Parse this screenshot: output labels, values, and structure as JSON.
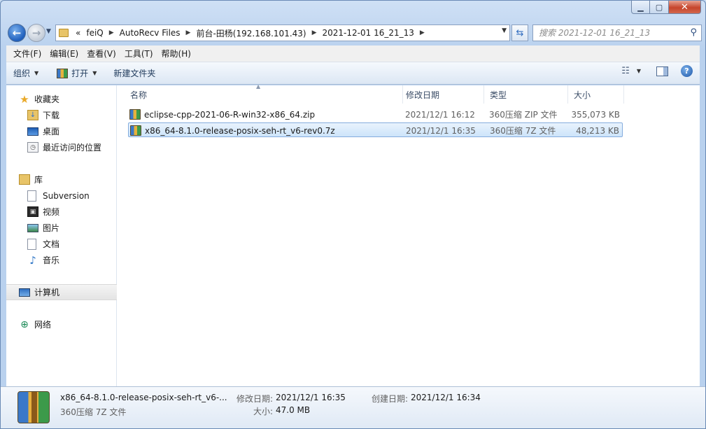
{
  "window": {
    "caption": {
      "minimize": "▁",
      "maximize": "▢",
      "close": "✕"
    }
  },
  "address": {
    "crumbs": [
      "«",
      "feiQ",
      "AutoRecv Files",
      "前台-田杨(192.168.101.43)",
      "2021-12-01 16_21_13"
    ],
    "separator": "▶",
    "dropdown": "▼"
  },
  "search": {
    "placeholder": "搜索 2021-12-01 16_21_13",
    "icon": "search-icon"
  },
  "menu": [
    "文件(F)",
    "编辑(E)",
    "查看(V)",
    "工具(T)",
    "帮助(H)"
  ],
  "toolbar": {
    "organize": "组织",
    "open": "打开",
    "new_folder": "新建文件夹",
    "dropdown": "▼"
  },
  "nav": {
    "favorites": {
      "label": "收藏夹",
      "items": [
        "下载",
        "桌面",
        "最近访问的位置"
      ]
    },
    "libraries": {
      "label": "库",
      "items": [
        "Subversion",
        "视频",
        "图片",
        "文档",
        "音乐"
      ]
    },
    "computer": {
      "label": "计算机"
    },
    "network": {
      "label": "网络"
    }
  },
  "columns": {
    "name": "名称",
    "date": "修改日期",
    "type": "类型",
    "size": "大小"
  },
  "files": [
    {
      "name": "eclipse-cpp-2021-06-R-win32-x86_64.zip",
      "date": "2021/12/1 16:12",
      "type": "360压缩 ZIP 文件",
      "size": "355,073 KB"
    },
    {
      "name": "x86_64-8.1.0-release-posix-seh-rt_v6-rev0.7z",
      "date": "2021/12/1 16:35",
      "type": "360压缩 7Z 文件",
      "size": "48,213 KB"
    }
  ],
  "details": {
    "name": "x86_64-8.1.0-release-posix-seh-rt_v6-...",
    "type": "360压缩 7Z 文件",
    "modified_label": "修改日期:",
    "modified": "2021/12/1 16:35",
    "created_label": "创建日期:",
    "created": "2021/12/1 16:34",
    "size_label": "大小:",
    "size": "47.0 MB"
  }
}
